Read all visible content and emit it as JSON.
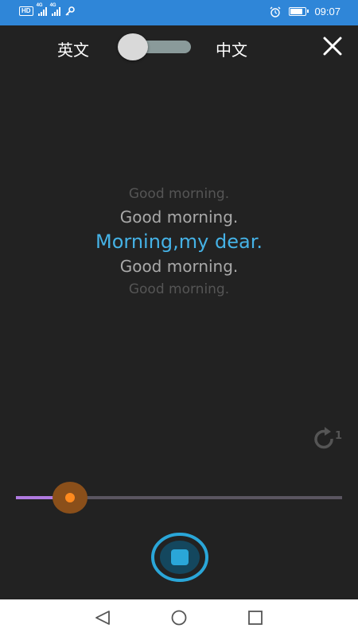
{
  "status_bar": {
    "hd_label": "HD",
    "signal_labels": [
      "4G",
      "4G"
    ],
    "time": "09:07",
    "icons": [
      "hd-icon",
      "signal-icon",
      "signal-icon",
      "key-icon",
      "alarm-icon",
      "battery-icon"
    ],
    "battery_level": 0.9,
    "bg_color": "#2f86d8"
  },
  "header": {
    "left_language": "英文",
    "right_language": "中文",
    "toggle_state": "off",
    "close_icon": "close-icon"
  },
  "lyrics": {
    "lines": [
      "Good morning.",
      "Good morning.",
      "Morning,my dear.",
      "Good morning.",
      "Good morning."
    ],
    "current_index": 2,
    "current_color": "#45b2e6"
  },
  "repeat": {
    "icon": "repeat-one-icon",
    "count": "1"
  },
  "player": {
    "progress": 0.165,
    "track_color": "#b07ae0",
    "thumb_color": "#ff8a1e",
    "stop_icon": "stop-icon",
    "accent": "#2aa6d8"
  },
  "nav_bar": {
    "icons": [
      "back-icon",
      "home-icon",
      "recents-icon"
    ]
  }
}
